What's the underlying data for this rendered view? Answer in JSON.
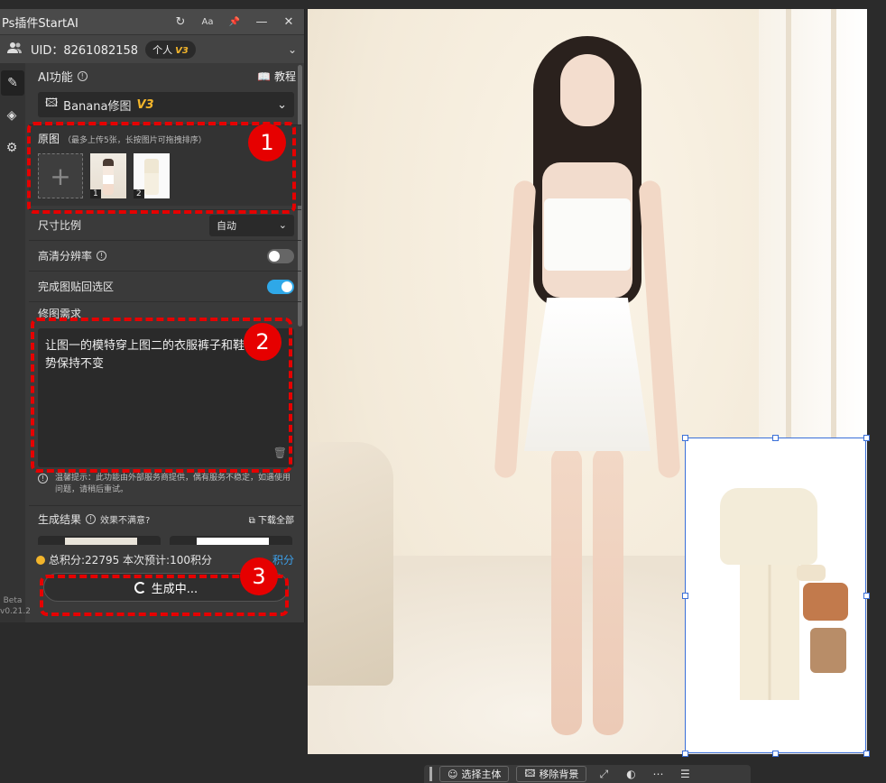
{
  "panel": {
    "title": "Ps插件StartAI",
    "title_icons": [
      "refresh-icon",
      "font-size-icon",
      "pin-icon",
      "minimize-icon",
      "close-icon"
    ],
    "title_glyphs": [
      "↻",
      "Aa",
      "📌",
      "—",
      "✕"
    ],
    "uid_label": "UID：8261082158",
    "plan": "个人",
    "plan_badge": "V3",
    "ai_function_label": "AI功能",
    "tutorial_label": "教程",
    "selected_function": "Banana修图",
    "selected_badge": "V3",
    "source_title": "原图",
    "source_hint": "（最多上传5张，长按图片可拖拽排序）",
    "thumb_numbers": [
      "1",
      "2"
    ],
    "size_ratio_label": "尺寸比例",
    "size_ratio_value": "自动",
    "hd_label": "高清分辨率",
    "hd_on": false,
    "paste_back_label": "完成图贴回选区",
    "paste_back_on": true,
    "prompt_title": "修图需求",
    "prompt_text": "让图一的模特穿上图二的衣服裤子和鞋子，姿势保持不变",
    "tip_text": "温馨提示：此功能由外部服务商提供，偶有服务不稳定，如遇使用问题，请稍后重试。",
    "results_label": "生成结果",
    "unsatisfied_label": "效果不满意?",
    "download_all_label": "下载全部",
    "points_text": "总积分:22795  本次预计:100积分",
    "points_link": "积分",
    "generate_label": "生成中...",
    "beta_label": "Beta",
    "version_label": "v0.21.2"
  },
  "annotations": [
    "1",
    "2",
    "3"
  ],
  "toolbar": {
    "select_subject": "选择主体",
    "remove_bg": "移除背景"
  },
  "colors": {
    "accent": "#2fa8e8",
    "badge_gold": "#f3b52b",
    "annotation_red": "#e60000",
    "selection_blue": "#3a6fd8"
  }
}
